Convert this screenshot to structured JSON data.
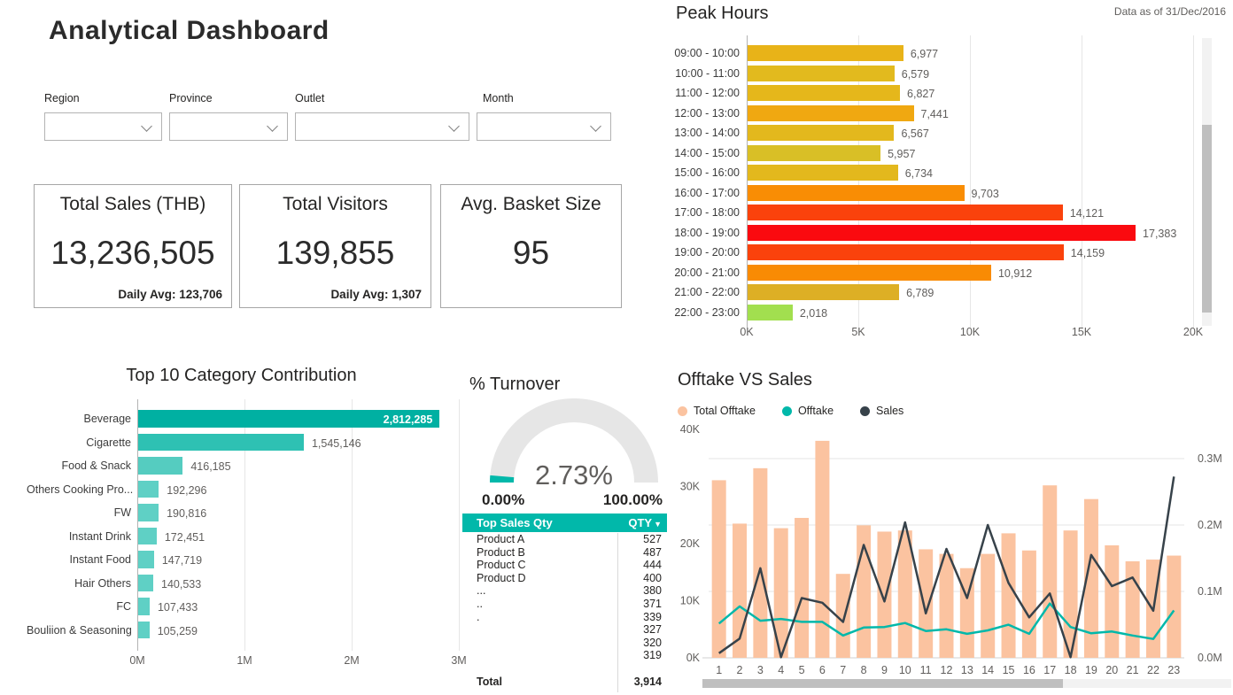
{
  "page": {
    "title": "Analytical Dashboard",
    "data_as_of": "Data as of 31/Dec/2016"
  },
  "filters": [
    {
      "label": "Region"
    },
    {
      "label": "Province"
    },
    {
      "label": "Outlet"
    },
    {
      "label": "Month"
    }
  ],
  "kpis": [
    {
      "title": "Total Sales (THB)",
      "value": "13,236,505",
      "subtext": "Daily Avg: 123,706"
    },
    {
      "title": "Total Visitors",
      "value": "139,855",
      "subtext": "Daily Avg: 1,307"
    },
    {
      "title": "Avg. Basket Size",
      "value": "95",
      "subtext": ""
    }
  ],
  "colors": {
    "accent_teal": "#01B8AA",
    "bar_peach": "#FBC3A0",
    "line_teal": "#01B8AA",
    "line_dark": "#37424A",
    "text_dark": "#252423",
    "text_gray": "#605E5C",
    "grid": "#E6E6E6",
    "axis": "#B3B3B3",
    "scroll_track": "#F2F2F2",
    "scroll_thumb": "#BFBFBF",
    "gauge_track": "#E6E6E6"
  },
  "chart_data": [
    {
      "id": "peak_hours",
      "type": "bar",
      "orientation": "horizontal",
      "title": "Peak Hours",
      "categories": [
        "09:00 - 10:00",
        "10:00 - 11:00",
        "11:00 - 12:00",
        "12:00 - 13:00",
        "13:00 - 14:00",
        "14:00 - 15:00",
        "15:00 - 16:00",
        "16:00 - 17:00",
        "17:00 - 18:00",
        "18:00 - 19:00",
        "19:00 - 20:00",
        "20:00 - 21:00",
        "21:00 - 22:00",
        "22:00 - 23:00"
      ],
      "values": [
        6977,
        6579,
        6827,
        7441,
        6567,
        5957,
        6734,
        9703,
        14121,
        17383,
        14159,
        10912,
        6789,
        2018
      ],
      "value_labels": [
        "6,977",
        "6,579",
        "6,827",
        "7,441",
        "6,567",
        "5,957",
        "6,734",
        "9,703",
        "14,121",
        "17,383",
        "14,159",
        "10,912",
        "6,789",
        "2,018"
      ],
      "bar_colors": [
        "#E8B318",
        "#E2BA1E",
        "#E5B71B",
        "#F0A811",
        "#E3B81D",
        "#D9BF26",
        "#E3B81D",
        "#F98D04",
        "#FA420C",
        "#FA0A0F",
        "#FA420C",
        "#F98B04",
        "#DDAF25",
        "#A2DF4F"
      ],
      "x_ticks": [
        "0K",
        "5K",
        "10K",
        "15K",
        "20K"
      ],
      "xlim": [
        0,
        20000
      ],
      "grid": true,
      "scrollbar": "right"
    },
    {
      "id": "category_contribution",
      "type": "bar",
      "orientation": "horizontal",
      "title": "Top 10 Category Contribution",
      "categories": [
        "Beverage",
        "Cigarette",
        "Food & Snack",
        "Others Cooking Pro...",
        "FW",
        "Instant Drink",
        "Instant Food",
        "Hair Others",
        "FC",
        "Bouliion & Seasoning"
      ],
      "values": [
        2812285,
        1545146,
        416185,
        192296,
        190816,
        172451,
        147719,
        140533,
        107433,
        105259
      ],
      "value_labels": [
        "2,812,285",
        "1,545,146",
        "416,185",
        "192,296",
        "190,816",
        "172,451",
        "147,719",
        "140,533",
        "107,433",
        "105,259"
      ],
      "bar_colors": [
        "#00B0A2",
        "#2EC1B3",
        "#55CCC0",
        "#5FD0C5",
        "#5FD0C5",
        "#5FD0C5",
        "#5FD0C5",
        "#5FD0C5",
        "#5FD0C5",
        "#5FD0C5"
      ],
      "x_ticks": [
        "0M",
        "1M",
        "2M",
        "3M"
      ],
      "xlim": [
        0,
        3000000
      ],
      "grid": true
    },
    {
      "id": "turnover_gauge",
      "type": "gauge",
      "title": "% Turnover",
      "value": 2.73,
      "value_label": "2.73%",
      "min": 0,
      "max": 100,
      "min_label": "0.00%",
      "max_label": "100.00%"
    },
    {
      "id": "top_sales_table",
      "type": "table",
      "columns": [
        "Top Sales Qty",
        "QTY"
      ],
      "sort_icon": "▼",
      "rows": [
        [
          "Product A",
          "527"
        ],
        [
          "Product B",
          "487"
        ],
        [
          "Product C",
          "444"
        ],
        [
          "Product D",
          "400"
        ],
        [
          "...",
          "380"
        ],
        [
          "..",
          "371"
        ],
        [
          ".",
          "339"
        ],
        [
          "",
          "327"
        ],
        [
          "",
          "320"
        ],
        [
          "",
          "319"
        ]
      ],
      "total_row": [
        "Total",
        "3,914"
      ]
    },
    {
      "id": "offtake_vs_sales",
      "type": "combo",
      "title": "Offtake VS Sales",
      "legend": [
        {
          "label": "Total Offtake",
          "color": "#FBC3A0"
        },
        {
          "label": "Offtake",
          "color": "#01B8AA"
        },
        {
          "label": "Sales",
          "color": "#37424A"
        }
      ],
      "x": [
        1,
        2,
        3,
        4,
        5,
        6,
        7,
        8,
        9,
        10,
        11,
        12,
        13,
        14,
        15,
        16,
        17,
        18,
        19,
        20,
        21,
        22,
        23
      ],
      "series": [
        {
          "name": "Total Offtake",
          "type": "bar",
          "axis": "left",
          "values": [
            31100,
            23500,
            33200,
            22700,
            24500,
            38000,
            14700,
            23200,
            22100,
            22300,
            19000,
            18200,
            15700,
            18200,
            21800,
            18800,
            30200,
            22300,
            27800,
            19700,
            16900,
            17200,
            17900
          ]
        },
        {
          "name": "Offtake",
          "type": "line",
          "axis": "left",
          "values": [
            6000,
            9000,
            6500,
            6800,
            6300,
            6300,
            3900,
            5300,
            5400,
            6100,
            4700,
            5000,
            4200,
            4800,
            5800,
            4200,
            9500,
            5400,
            4300,
            4600,
            3900,
            3300,
            8300
          ]
        },
        {
          "name": "Sales",
          "type": "line",
          "axis": "right",
          "values": [
            7000,
            29000,
            135000,
            1000,
            90000,
            83000,
            54000,
            170000,
            85000,
            204000,
            67000,
            164000,
            90000,
            200000,
            113000,
            61000,
            97000,
            1000,
            155000,
            108000,
            121000,
            71000,
            273000
          ]
        }
      ],
      "left_ticks": [
        "0K",
        "10K",
        "20K",
        "30K",
        "40K"
      ],
      "left_lim": [
        0,
        40000
      ],
      "right_ticks": [
        "0.0M",
        "0.1M",
        "0.2M",
        "0.3M"
      ],
      "right_lim": [
        0,
        344000
      ],
      "grid": true,
      "scrollbar": "bottom"
    }
  ]
}
